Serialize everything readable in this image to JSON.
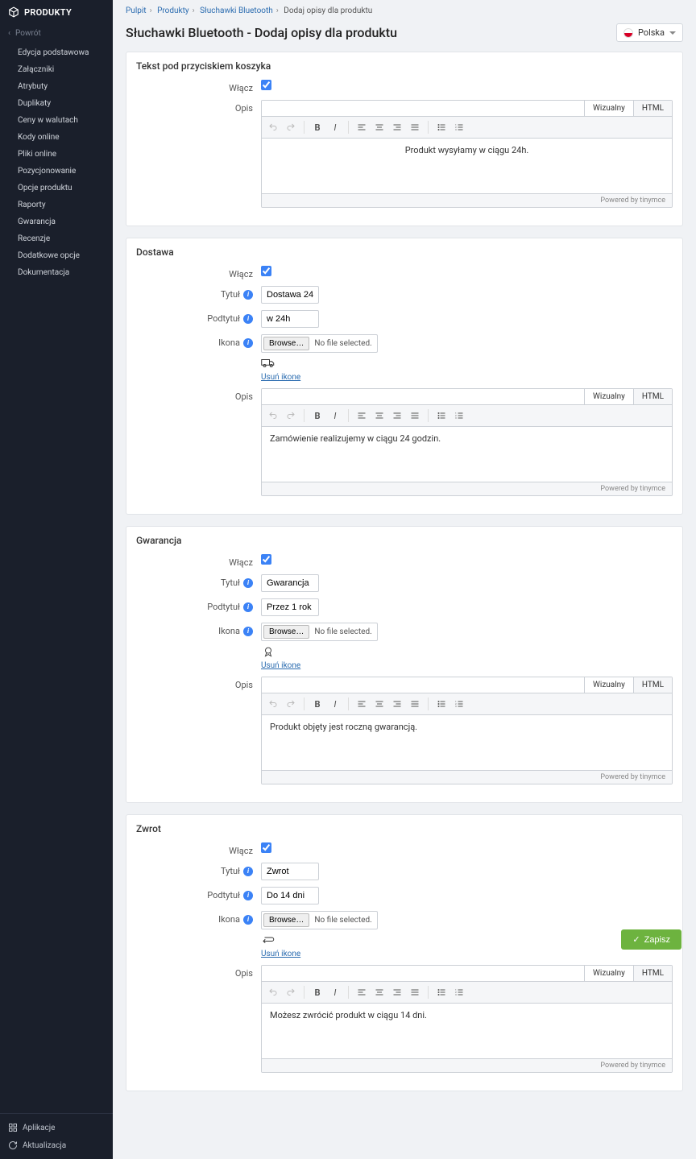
{
  "app": {
    "name": "PRODUKTY",
    "back": "Powrót"
  },
  "nav": [
    "Edycja podstawowa",
    "Załączniki",
    "Atrybuty",
    "Duplikaty",
    "Ceny w walutach",
    "Kody online",
    "Pliki online",
    "Pozycjonowanie",
    "Opcje produktu",
    "Raporty",
    "Gwarancja",
    "Recenzje",
    "Dodatkowe opcje",
    "Dokumentacja"
  ],
  "sidebar_footer": {
    "apps": "Aplikacje",
    "update": "Aktualizacja"
  },
  "breadcrumb": {
    "a": "Pulpit",
    "b": "Produkty",
    "c": "Słuchawki Bluetooth",
    "d": "Dodaj opisy dla produktu"
  },
  "page_title": "Słuchawki Bluetooth - Dodaj opisy dla produktu",
  "lang": {
    "label": "Polska"
  },
  "labels": {
    "enable": "Włącz",
    "title": "Tytuł",
    "subtitle": "Podtytuł",
    "icon": "Ikona",
    "desc": "Opis",
    "browse": "Browse…",
    "nofile": "No file selected.",
    "remove_icon": "Usuń ikone",
    "visual": "Wizualny",
    "html": "HTML",
    "powered": "Powered by tinymce"
  },
  "sections": {
    "s1": {
      "title": "Tekst pod przyciskiem koszyka",
      "enabled": true,
      "desc": "Produkt wysyłamy w ciągu 24h."
    },
    "s2": {
      "title": "Dostawa",
      "enabled": true,
      "field_title": "Dostawa 24",
      "field_subtitle": "w 24h",
      "desc": "Zamówienie realizujemy w ciągu 24 godzin."
    },
    "s3": {
      "title": "Gwarancja",
      "enabled": true,
      "field_title": "Gwarancja",
      "field_subtitle": "Przez 1 rok",
      "desc": "Produkt objęty jest roczną gwarancją."
    },
    "s4": {
      "title": "Zwrot",
      "enabled": true,
      "field_title": "Zwrot",
      "field_subtitle": "Do 14 dni",
      "desc": "Możesz zwrócić produkt w ciągu 14 dni."
    }
  },
  "save": "Zapisz"
}
